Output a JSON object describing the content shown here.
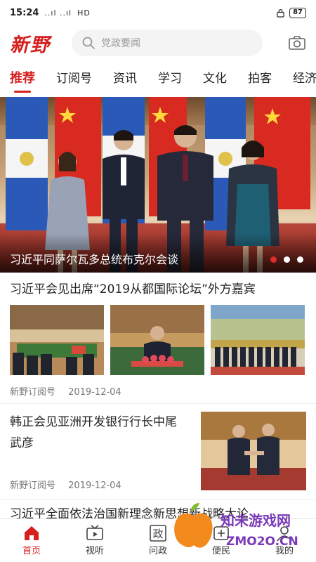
{
  "status_bar": {
    "time": "15:24",
    "signal": "..ıl ..ıl",
    "network": "HD",
    "battery": "87"
  },
  "header": {
    "logo": "新野",
    "search_placeholder": "党政要闻"
  },
  "tabs": [
    "推荐",
    "订阅号",
    "资讯",
    "学习",
    "文化",
    "拍客",
    "经济"
  ],
  "hero": {
    "caption": "习近平同萨尔瓦多总统布克尔会谈",
    "slide_count": 3,
    "active_slide": 0
  },
  "articles": [
    {
      "title": "习近平会见出席“2019从都国际论坛”外方嘉宾",
      "source": "新野订阅号",
      "date": "2019-12-04"
    },
    {
      "title": "韩正会见亚洲开发银行行长中尾武彦",
      "source": "新野订阅号",
      "date": "2019-12-04"
    },
    {
      "title": "习近平全面依法治国新理念新思想新战略大论"
    }
  ],
  "bottom_nav": [
    {
      "label": "首页",
      "icon": "home-icon",
      "active": true
    },
    {
      "label": "视听",
      "icon": "tv-icon",
      "active": false
    },
    {
      "label": "问政",
      "icon": "politics-icon",
      "active": false
    },
    {
      "label": "便民",
      "icon": "service-icon",
      "active": false
    },
    {
      "label": "我的",
      "icon": "user-icon",
      "active": false
    }
  ],
  "watermark": {
    "text": "知未游戏网",
    "url": "ZMO2O.CN"
  },
  "colors": {
    "accent": "#d61f1f",
    "text": "#222222",
    "meta": "#777777"
  }
}
